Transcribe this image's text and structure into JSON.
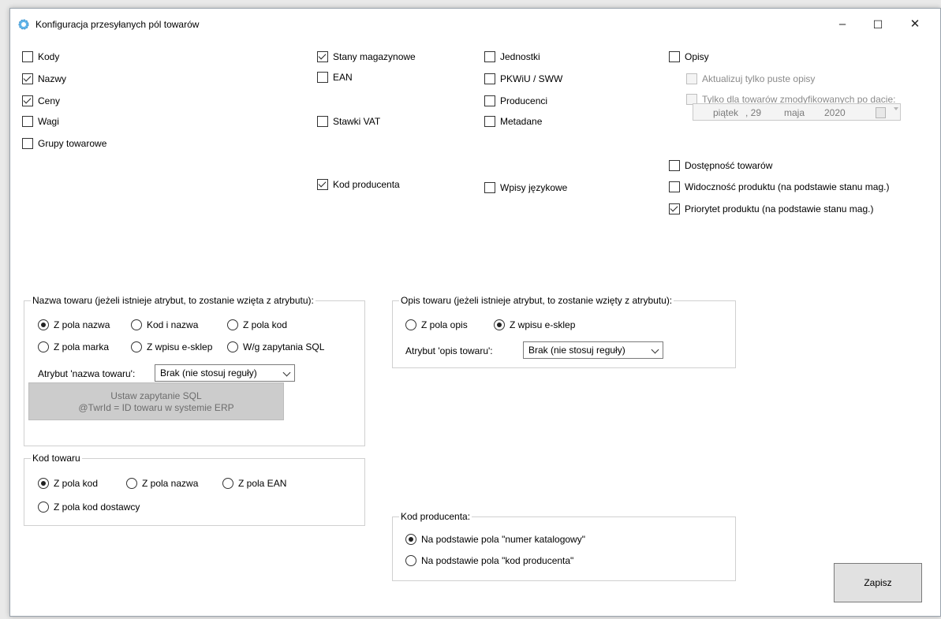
{
  "window": {
    "title": "Konfiguracja przesyłanych pól towarów",
    "minimize": "–",
    "maximize": "☐",
    "close": "✕"
  },
  "col1": [
    {
      "label": "Kody",
      "checked": false
    },
    {
      "label": "Nazwy",
      "checked": true
    },
    {
      "label": "Ceny",
      "checked": true
    },
    {
      "label": "Wagi",
      "checked": false
    },
    {
      "label": "Grupy towarowe",
      "checked": false
    }
  ],
  "col2": {
    "stany": {
      "label": "Stany magazynowe",
      "checked": true
    },
    "ean": {
      "label": "EAN",
      "checked": false
    },
    "vat": {
      "label": "Stawki VAT",
      "checked": false
    },
    "kod_producenta": {
      "label": "Kod producenta",
      "checked": true
    }
  },
  "col3": {
    "jednostki": {
      "label": "Jednostki",
      "checked": false
    },
    "pkwiu": {
      "label": "PKWiU / SWW",
      "checked": false
    },
    "producenci": {
      "label": "Producenci",
      "checked": false
    },
    "metadane": {
      "label": "Metadane",
      "checked": false
    },
    "wpisy": {
      "label": "Wpisy językowe",
      "checked": false
    }
  },
  "col4": {
    "opisy": {
      "label": "Opisy",
      "checked": false
    },
    "aktualizuj": {
      "label": "Aktualizuj tylko puste opisy",
      "checked": false,
      "disabled": true
    },
    "tylko": {
      "label": "Tylko dla towarów zmodyfikowanych po dacie:",
      "checked": false,
      "disabled": true
    },
    "date": {
      "day_name": "piątek",
      "day": ", 29",
      "month": "maja",
      "year": "2020"
    },
    "dostepnosc": {
      "label": "Dostępność towarów",
      "checked": false
    },
    "widocznosc": {
      "label": "Widoczność produktu (na podstawie stanu mag.)",
      "checked": false
    },
    "priorytet": {
      "label": "Priorytet produktu (na podstawie stanu mag.)",
      "checked": true
    }
  },
  "nazwa_group": {
    "legend": "Nazwa towaru (jeżeli istnieje atrybut, to zostanie wzięta z atrybutu):",
    "radios": [
      "Z pola nazwa",
      "Kod i nazwa",
      "Z pola kod",
      "Z pola marka",
      "Z wpisu e-sklep",
      "W/g zapytania SQL"
    ],
    "selected": 0,
    "attr_label": "Atrybut 'nazwa towaru':",
    "attr_value": "Brak (nie stosuj reguły)",
    "sql_button_line1": "Ustaw zapytanie SQL",
    "sql_button_line2": "@TwrId = ID towaru w systemie ERP"
  },
  "kod_group": {
    "legend": "Kod towaru",
    "radios": [
      "Z pola kod",
      "Z pola nazwa",
      "Z pola EAN",
      "Z pola kod dostawcy"
    ],
    "selected": 0
  },
  "opis_group": {
    "legend": "Opis towaru (jeżeli istnieje atrybut, to zostanie wzięty z atrybutu):",
    "radios": [
      "Z pola opis",
      "Z wpisu e-sklep"
    ],
    "selected": 1,
    "attr_label": "Atrybut 'opis towaru':",
    "attr_value": "Brak (nie stosuj reguły)"
  },
  "kodprod_group": {
    "legend": "Kod producenta:",
    "radios": [
      "Na podstawie pola \"numer katalogowy\"",
      "Na podstawie pola \"kod producenta\""
    ],
    "selected": 0
  },
  "save_label": "Zapisz"
}
